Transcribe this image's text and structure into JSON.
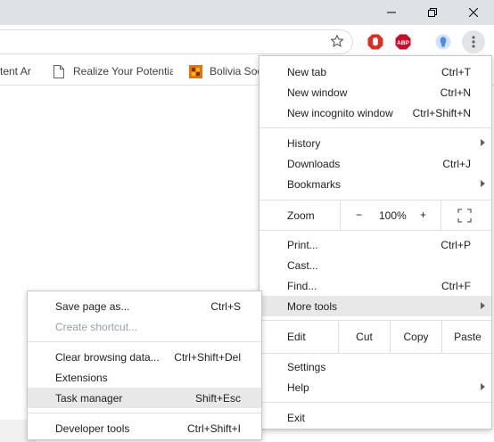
{
  "window_controls": {
    "minimize_icon": "minimize-icon",
    "maximize_icon": "restore-icon",
    "close_icon": "close-icon"
  },
  "toolbar": {
    "star_icon": "star-icon",
    "extensions": [
      {
        "name": "adblock-icon",
        "color": "#d93025"
      },
      {
        "name": "abp-icon",
        "label": "ABP",
        "color": "#c70d2c"
      },
      {
        "name": "profile-icon",
        "color": "#8ab4f8"
      }
    ]
  },
  "bookmarks": [
    {
      "label": "tent Ar"
    },
    {
      "label": "Realize Your Potential"
    },
    {
      "label": "Bolivia Soc"
    }
  ],
  "main_menu": {
    "new_tab": {
      "label": "New tab",
      "shortcut": "Ctrl+T"
    },
    "new_window": {
      "label": "New window",
      "shortcut": "Ctrl+N"
    },
    "new_incognito": {
      "label": "New incognito window",
      "shortcut": "Ctrl+Shift+N"
    },
    "history": {
      "label": "History"
    },
    "downloads": {
      "label": "Downloads",
      "shortcut": "Ctrl+J"
    },
    "bookmarks": {
      "label": "Bookmarks"
    },
    "zoom": {
      "label": "Zoom",
      "minus": "−",
      "value": "100%",
      "plus": "+"
    },
    "print": {
      "label": "Print...",
      "shortcut": "Ctrl+P"
    },
    "cast": {
      "label": "Cast..."
    },
    "find": {
      "label": "Find...",
      "shortcut": "Ctrl+F"
    },
    "more_tools": {
      "label": "More tools"
    },
    "edit": {
      "label": "Edit",
      "cut": "Cut",
      "copy": "Copy",
      "paste": "Paste"
    },
    "settings": {
      "label": "Settings"
    },
    "help": {
      "label": "Help"
    },
    "exit": {
      "label": "Exit"
    }
  },
  "sub_menu": {
    "save_page": {
      "label": "Save page as...",
      "shortcut": "Ctrl+S"
    },
    "create_shortcut": {
      "label": "Create shortcut..."
    },
    "clear_data": {
      "label": "Clear browsing data...",
      "shortcut": "Ctrl+Shift+Del"
    },
    "extensions": {
      "label": "Extensions"
    },
    "task_manager": {
      "label": "Task manager",
      "shortcut": "Shift+Esc"
    },
    "dev_tools": {
      "label": "Developer tools",
      "shortcut": "Ctrl+Shift+I"
    }
  }
}
